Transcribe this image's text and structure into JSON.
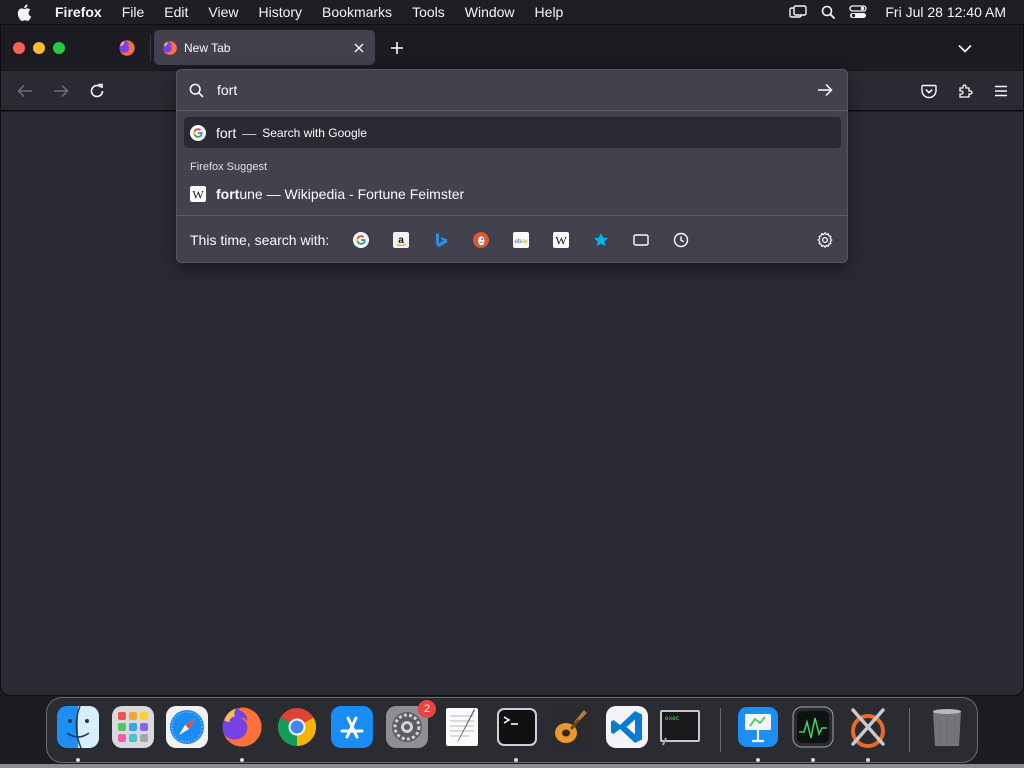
{
  "menubar": {
    "app_name": "Firefox",
    "items": [
      "File",
      "Edit",
      "View",
      "History",
      "Bookmarks",
      "Tools",
      "Window",
      "Help"
    ],
    "clock": "Fri Jul 28  12:40 AM"
  },
  "tabs": {
    "active_label": "New Tab"
  },
  "urlbar": {
    "typed_text": "fort",
    "heuristic": {
      "text": "fort",
      "separator": "—",
      "action": "Search with Google"
    },
    "group_label": "Firefox Suggest",
    "suggest": {
      "bold_part": "fort",
      "rest": "une — Wikipedia - Fortune Feimster"
    },
    "oneoff_label": "This time, search with:",
    "engines": [
      "google",
      "amazon",
      "bing",
      "duckduckgo",
      "ebay",
      "wikipedia",
      "bookmarks",
      "tabs",
      "history"
    ]
  },
  "dock": {
    "apps": [
      "Finder",
      "Launchpad",
      "Safari",
      "Firefox",
      "Chrome",
      "App Store",
      "System Settings",
      "TextEdit",
      "Terminal",
      "GarageBand",
      "VS Code",
      "Script Editor",
      "Keynote",
      "Activity Monitor",
      "Instruments",
      "Trash"
    ],
    "settings_badge": "2"
  },
  "colors": {
    "accent": "#00b3f4",
    "tab_bg": "#42414d",
    "window_bg": "#1c1b22"
  }
}
